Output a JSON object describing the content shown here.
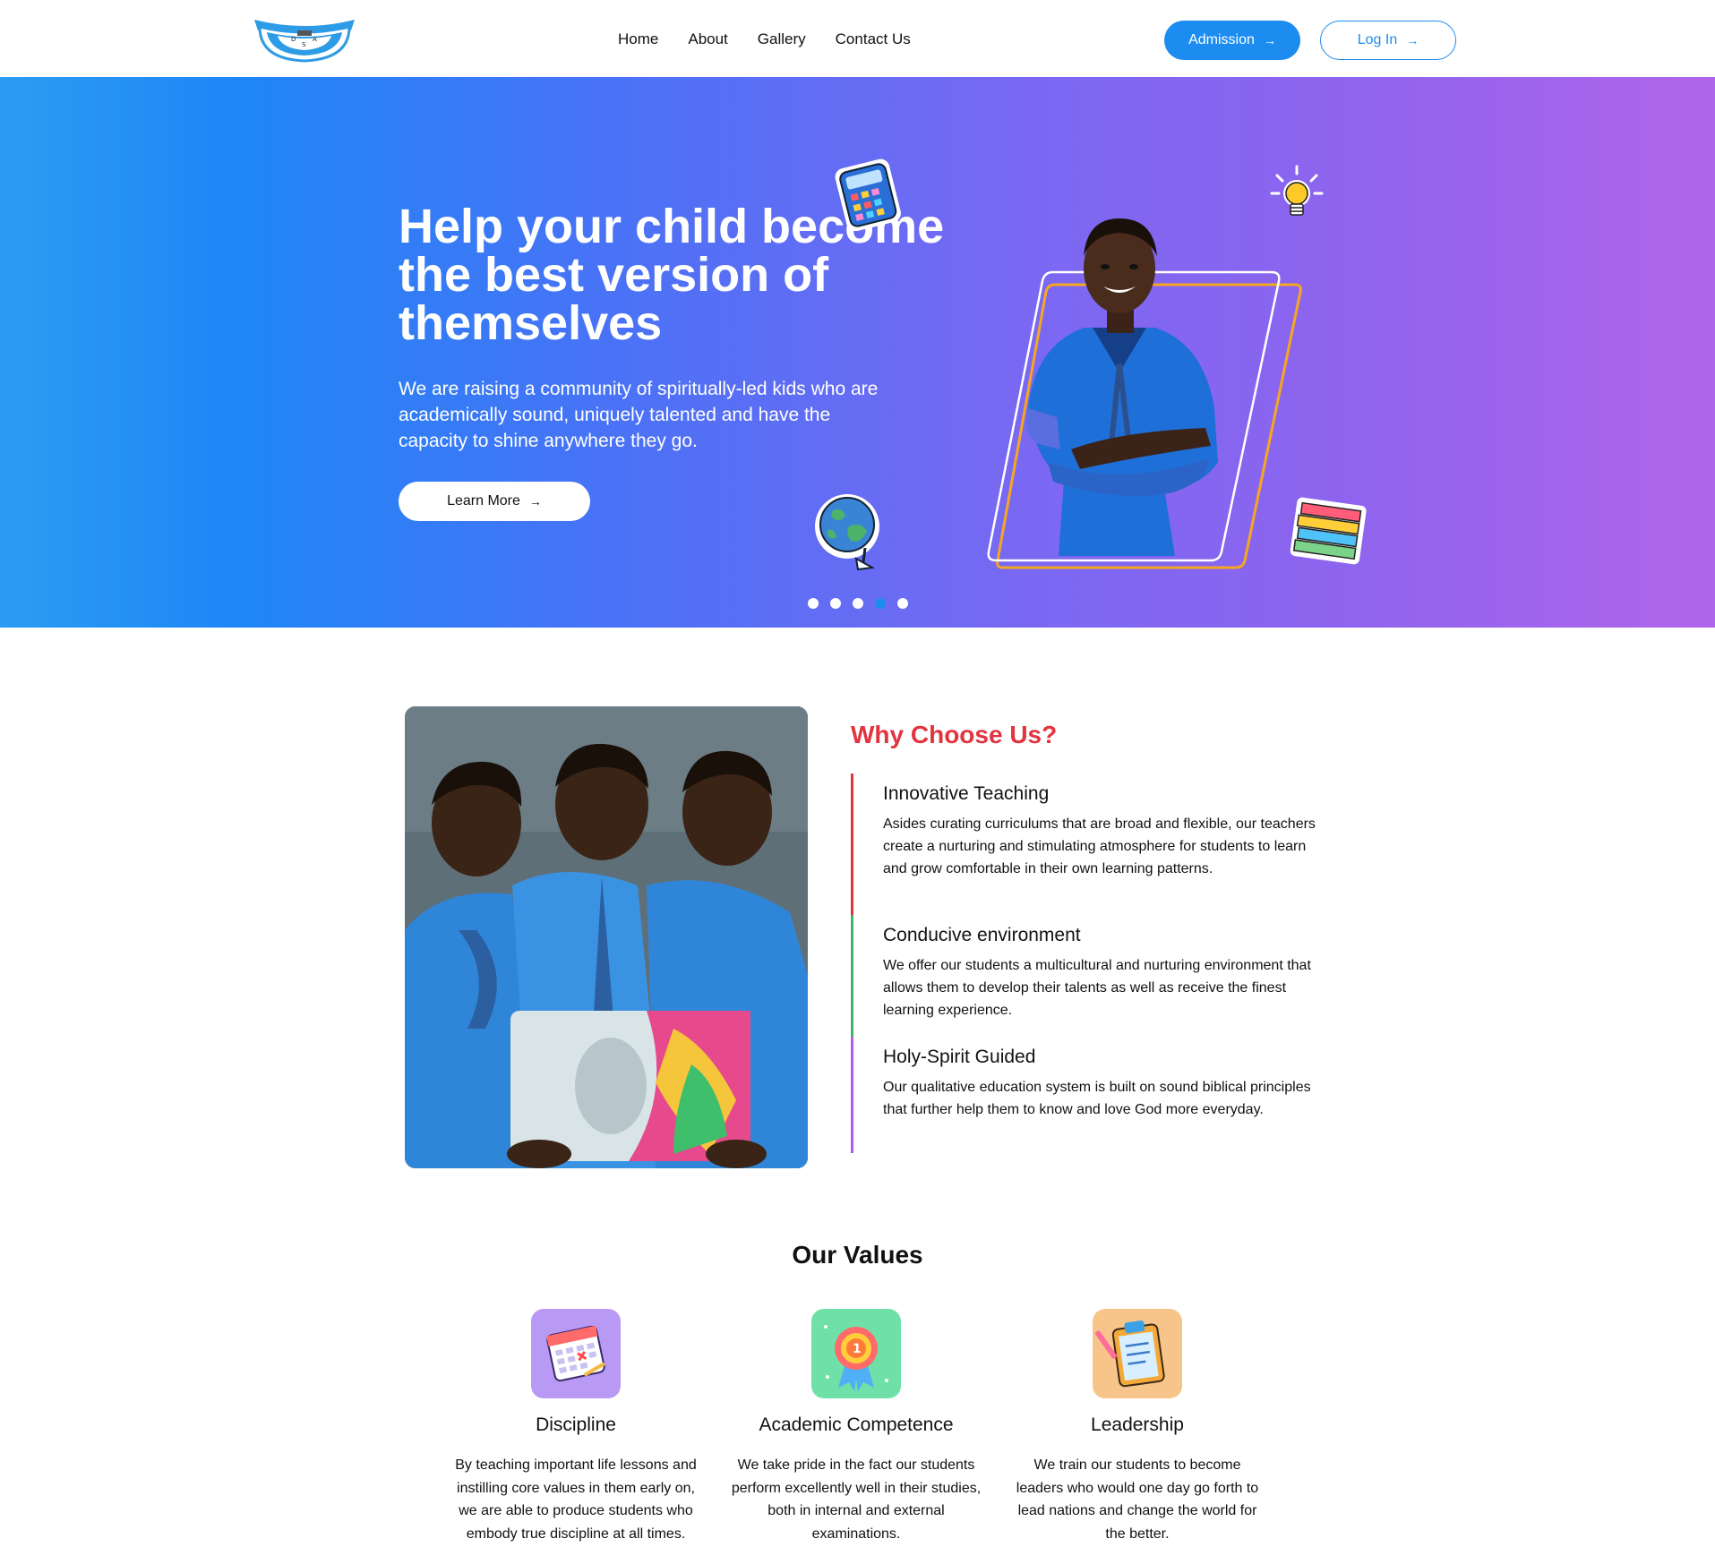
{
  "header": {
    "logo_alt": "Dayspring Academy",
    "nav": [
      "Home",
      "About",
      "Gallery",
      "Contact Us"
    ],
    "admission_label": "Admission",
    "login_label": "Log In"
  },
  "hero": {
    "title": "Help your child become the best version of themselves",
    "subtitle": "We are raising a community of spiritually-led kids who are academically sound, uniquely talented and have the capacity to shine anywhere they go.",
    "cta_label": "Learn More",
    "slide_count": 5,
    "active_slide": 4
  },
  "why": {
    "title": "Why Choose Us?",
    "items": [
      {
        "heading": "Innovative Teaching",
        "text": "Asides curating curriculums that are broad and flexible, our teachers create a nurturing and stimulating atmosphere for students to learn and grow comfortable in their own learning patterns.",
        "color": "#e1343f"
      },
      {
        "heading": "Conducive environment",
        "text": "We offer our students a multicultural and nurturing environment that allows them to develop their talents as well as receive the finest learning experience.",
        "color": "#3fb56b"
      },
      {
        "heading": "Holy-Spirit Guided",
        "text": "Our qualitative education system is built on sound biblical principles that further help them to know and love God more everyday.",
        "color": "#b05ce8"
      }
    ]
  },
  "values": {
    "title": "Our Values",
    "items": [
      {
        "heading": "Discipline",
        "text": "By teaching important life lessons and instilling core values in them early on, we are able to produce students who embody true discipline at all times.",
        "icon": "calendar-icon",
        "color": "#b89af5"
      },
      {
        "heading": "Academic Competence",
        "text": "We take pride in the fact our students perform excellently well in their studies, both in internal and external examinations.",
        "icon": "medal-icon",
        "color": "#6fe0a8"
      },
      {
        "heading": "Leadership",
        "text": "We train our students to become leaders who would one day go forth to lead nations and change the world for the better.",
        "icon": "clipboard-icon",
        "color": "#f7c58a"
      }
    ]
  },
  "colors": {
    "primary": "#1c8cf0",
    "accent_red": "#e1343f"
  }
}
